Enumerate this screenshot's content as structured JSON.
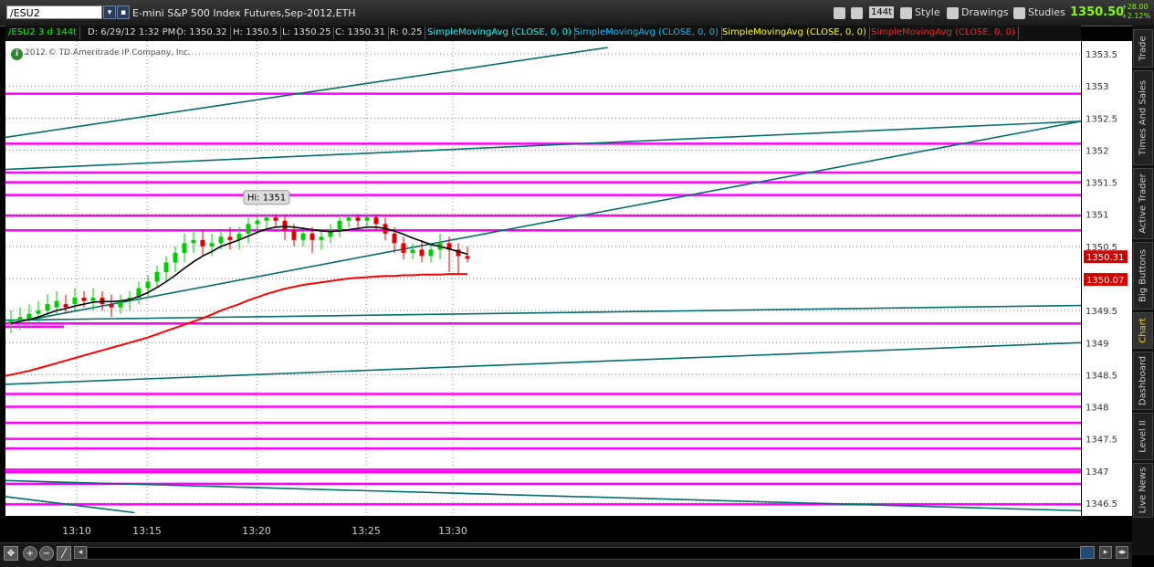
{
  "toolbar": {
    "symbol": "/ESU2",
    "instrument_title": "E-mini S&P 500 Index Futures,Sep-2012,ETH",
    "tick_label": "144t",
    "style_label": "Style",
    "drawings_label": "Drawings",
    "studies_label": "Studies",
    "last_price": "1350.50",
    "change_abs": "+28.00",
    "change_pct": "+2.12%"
  },
  "infobar": {
    "period": "/ESU2 3 d 144t",
    "date": "D: 6/29/12 1:32 PM",
    "open": "O: 1350.32",
    "high": "H: 1350.5",
    "low": "L: 1350.25",
    "close": "C: 1350.31",
    "range": "R: 0.25",
    "studies": [
      {
        "label": "SimpleMovingAvg (CLOSE, 0, 0)",
        "color": "#00ffff"
      },
      {
        "label": "SimpleMovingAvg (CLOSE, 0, 0)",
        "color": "#00bfff"
      },
      {
        "label": "SimpleMovingAvg (CLOSE, 0, 0)",
        "color": "#ffff00"
      },
      {
        "label": "SimpleMovingAvg (CLOSE, 0, 0)",
        "color": "#ff2020"
      }
    ]
  },
  "copyright": "2012 © TD Ameritrade IP Company, Inc.",
  "sidebar_tabs": [
    "Trade",
    "Times And Sales",
    "Active Trader",
    "Big Buttons",
    "Chart",
    "Dashboard",
    "Level II",
    "Live News"
  ],
  "colors": {
    "up": "#00cc00",
    "down": "#dd0000",
    "sma_fast": "#000000",
    "sma_slow": "#ff0000",
    "trendline": "#006f6f",
    "level": "#ff00ff",
    "last_price": "#7fff00"
  },
  "chart_data": {
    "type": "candlestick",
    "y_ticks": [
      "1353.5",
      "1353",
      "1352.5",
      "1352",
      "1351.5",
      "1351",
      "1350.5",
      "1350",
      "1349.5",
      "1349",
      "1348.5",
      "1348",
      "1347.5",
      "1347",
      "1346.5"
    ],
    "ylim": [
      1346.3,
      1353.7
    ],
    "x_ticks": [
      "13:10",
      "13:15",
      "13:20",
      "13:25",
      "13:30"
    ],
    "high_annotation": "Hi: 1351",
    "price_markers": [
      {
        "label": "1350.31",
        "value": 1350.31
      },
      {
        "label": "1350.07",
        "value": 1350.07
      }
    ],
    "horizontal_levels": [
      1352.88,
      1352.1,
      1351.65,
      1351.5,
      1351.3,
      1350.98,
      1350.75,
      1349.3,
      1348.2,
      1348.0,
      1347.75,
      1347.5,
      1347.35,
      1347.02,
      1346.98,
      1346.8,
      1346.48
    ],
    "trend_lines": [
      {
        "from": [
          0,
          1352.2
        ],
        "to": [
          0.56,
          1353.6
        ]
      },
      {
        "from": [
          0,
          1351.7
        ],
        "to": [
          1.0,
          1352.45
        ]
      },
      {
        "from": [
          0.02,
          1349.35
        ],
        "to": [
          1.0,
          1352.45
        ]
      },
      {
        "from": [
          0,
          1349.35
        ],
        "to": [
          1.0,
          1349.58
        ]
      },
      {
        "from": [
          0,
          1348.35
        ],
        "to": [
          1.0,
          1349.0
        ]
      },
      {
        "from": [
          0,
          1346.85
        ],
        "to": [
          1.0,
          1346.38
        ]
      },
      {
        "from": [
          0,
          1346.6
        ],
        "to": [
          0.12,
          1346.35
        ]
      }
    ],
    "candles": [
      {
        "o": 1349.3,
        "h": 1349.5,
        "c": 1349.35,
        "l": 1349.15
      },
      {
        "o": 1349.35,
        "h": 1349.55,
        "c": 1349.4,
        "l": 1349.2
      },
      {
        "o": 1349.35,
        "h": 1349.6,
        "c": 1349.45,
        "l": 1349.25
      },
      {
        "o": 1349.45,
        "h": 1349.65,
        "c": 1349.5,
        "l": 1349.3
      },
      {
        "o": 1349.5,
        "h": 1349.75,
        "c": 1349.6,
        "l": 1349.4
      },
      {
        "o": 1349.55,
        "h": 1349.8,
        "c": 1349.65,
        "l": 1349.45
      },
      {
        "o": 1349.6,
        "h": 1349.75,
        "c": 1349.55,
        "l": 1349.45
      },
      {
        "o": 1349.6,
        "h": 1349.85,
        "c": 1349.7,
        "l": 1349.5
      },
      {
        "o": 1349.7,
        "h": 1349.8,
        "c": 1349.65,
        "l": 1349.55
      },
      {
        "o": 1349.65,
        "h": 1349.85,
        "c": 1349.7,
        "l": 1349.5
      },
      {
        "o": 1349.7,
        "h": 1349.8,
        "c": 1349.6,
        "l": 1349.5
      },
      {
        "o": 1349.6,
        "h": 1349.75,
        "c": 1349.55,
        "l": 1349.4
      },
      {
        "o": 1349.55,
        "h": 1349.75,
        "c": 1349.65,
        "l": 1349.45
      },
      {
        "o": 1349.65,
        "h": 1349.8,
        "c": 1349.7,
        "l": 1349.5
      },
      {
        "o": 1349.7,
        "h": 1349.95,
        "c": 1349.85,
        "l": 1349.6
      },
      {
        "o": 1349.85,
        "h": 1350.05,
        "c": 1349.95,
        "l": 1349.7
      },
      {
        "o": 1349.95,
        "h": 1350.2,
        "c": 1350.1,
        "l": 1349.85
      },
      {
        "o": 1350.1,
        "h": 1350.35,
        "c": 1350.25,
        "l": 1349.95
      },
      {
        "o": 1350.25,
        "h": 1350.5,
        "c": 1350.4,
        "l": 1350.1
      },
      {
        "o": 1350.4,
        "h": 1350.7,
        "c": 1350.55,
        "l": 1350.25
      },
      {
        "o": 1350.55,
        "h": 1350.75,
        "c": 1350.6,
        "l": 1350.4
      },
      {
        "o": 1350.6,
        "h": 1350.75,
        "c": 1350.5,
        "l": 1350.35
      },
      {
        "o": 1350.5,
        "h": 1350.7,
        "c": 1350.55,
        "l": 1350.35
      },
      {
        "o": 1350.55,
        "h": 1350.75,
        "c": 1350.65,
        "l": 1350.45
      },
      {
        "o": 1350.65,
        "h": 1350.8,
        "c": 1350.6,
        "l": 1350.45
      },
      {
        "o": 1350.6,
        "h": 1350.8,
        "c": 1350.7,
        "l": 1350.45
      },
      {
        "o": 1350.7,
        "h": 1350.95,
        "c": 1350.85,
        "l": 1350.55
      },
      {
        "o": 1350.85,
        "h": 1351.0,
        "c": 1350.9,
        "l": 1350.7
      },
      {
        "o": 1350.9,
        "h": 1351.0,
        "c": 1350.95,
        "l": 1350.75
      },
      {
        "o": 1350.95,
        "h": 1351.0,
        "c": 1350.9,
        "l": 1350.8
      },
      {
        "o": 1350.9,
        "h": 1351.0,
        "c": 1350.75,
        "l": 1350.6
      },
      {
        "o": 1350.75,
        "h": 1350.85,
        "c": 1350.6,
        "l": 1350.5
      },
      {
        "o": 1350.6,
        "h": 1350.8,
        "c": 1350.7,
        "l": 1350.5
      },
      {
        "o": 1350.7,
        "h": 1350.8,
        "c": 1350.6,
        "l": 1350.4
      },
      {
        "o": 1350.6,
        "h": 1350.75,
        "c": 1350.65,
        "l": 1350.45
      },
      {
        "o": 1350.65,
        "h": 1350.85,
        "c": 1350.75,
        "l": 1350.55
      },
      {
        "o": 1350.75,
        "h": 1351.0,
        "c": 1350.9,
        "l": 1350.65
      },
      {
        "o": 1350.9,
        "h": 1351.0,
        "c": 1350.95,
        "l": 1350.8
      },
      {
        "o": 1350.95,
        "h": 1351.0,
        "c": 1350.9,
        "l": 1350.8
      },
      {
        "o": 1350.9,
        "h": 1351.0,
        "c": 1350.95,
        "l": 1350.8
      },
      {
        "o": 1350.95,
        "h": 1351.0,
        "c": 1350.85,
        "l": 1350.75
      },
      {
        "o": 1350.85,
        "h": 1350.95,
        "c": 1350.7,
        "l": 1350.6
      },
      {
        "o": 1350.7,
        "h": 1350.8,
        "c": 1350.55,
        "l": 1350.4
      },
      {
        "o": 1350.55,
        "h": 1350.65,
        "c": 1350.4,
        "l": 1350.3
      },
      {
        "o": 1350.4,
        "h": 1350.55,
        "c": 1350.45,
        "l": 1350.3
      },
      {
        "o": 1350.45,
        "h": 1350.6,
        "c": 1350.35,
        "l": 1350.25
      },
      {
        "o": 1350.35,
        "h": 1350.55,
        "c": 1350.45,
        "l": 1350.25
      },
      {
        "o": 1350.45,
        "h": 1350.7,
        "c": 1350.55,
        "l": 1350.3
      },
      {
        "o": 1350.55,
        "h": 1350.65,
        "c": 1350.45,
        "l": 1350.1
      },
      {
        "o": 1350.45,
        "h": 1350.55,
        "c": 1350.35,
        "l": 1350.05
      },
      {
        "o": 1350.35,
        "h": 1350.5,
        "c": 1350.31,
        "l": 1350.25
      }
    ],
    "sma_fast": [
      1349.3,
      1349.33,
      1349.36,
      1349.4,
      1349.45,
      1349.5,
      1349.53,
      1349.57,
      1349.6,
      1349.63,
      1349.64,
      1349.64,
      1349.65,
      1349.67,
      1349.72,
      1349.78,
      1349.86,
      1349.95,
      1350.05,
      1350.16,
      1350.26,
      1350.35,
      1350.42,
      1350.5,
      1350.55,
      1350.6,
      1350.66,
      1350.72,
      1350.77,
      1350.8,
      1350.81,
      1350.8,
      1350.78,
      1350.76,
      1350.74,
      1350.73,
      1350.74,
      1350.76,
      1350.78,
      1350.8,
      1350.8,
      1350.78,
      1350.74,
      1350.69,
      1350.63,
      1350.58,
      1350.53,
      1350.5,
      1350.46,
      1350.42,
      1350.38
    ],
    "sma_slow": [
      1348.5,
      1348.53,
      1348.56,
      1348.6,
      1348.64,
      1348.68,
      1348.72,
      1348.76,
      1348.8,
      1348.84,
      1348.88,
      1348.92,
      1348.96,
      1349.0,
      1349.04,
      1349.08,
      1349.13,
      1349.18,
      1349.23,
      1349.28,
      1349.33,
      1349.38,
      1349.44,
      1349.5,
      1349.55,
      1349.6,
      1349.66,
      1349.71,
      1349.76,
      1349.8,
      1349.84,
      1349.87,
      1349.9,
      1349.92,
      1349.94,
      1349.96,
      1349.98,
      1350.0,
      1350.01,
      1350.02,
      1350.03,
      1350.04,
      1350.04,
      1350.05,
      1350.05,
      1350.06,
      1350.06,
      1350.06,
      1350.07,
      1350.07,
      1350.07
    ]
  }
}
